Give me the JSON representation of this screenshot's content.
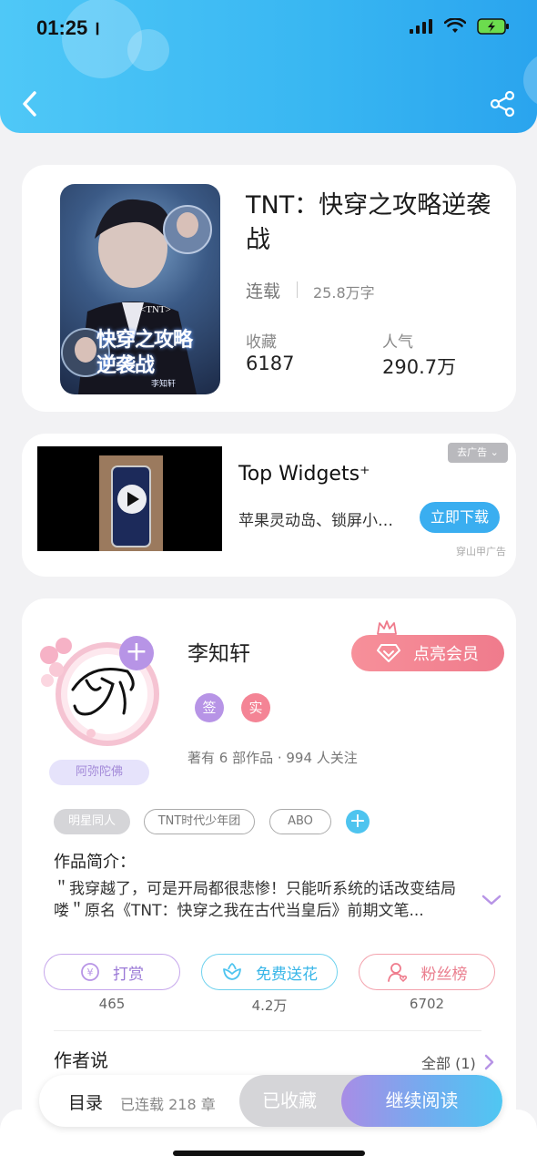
{
  "status_bar": {
    "time": "01:25"
  },
  "book": {
    "title": "TNT：快穿之攻略逆袭战",
    "status": "连载",
    "word_count": "25.8万字",
    "favorites_label": "收藏",
    "favorites_value": "6187",
    "popularity_label": "人气",
    "popularity_value": "290.7万",
    "cover_text_top": "<TNT>",
    "cover_title": "快穿之攻略逆袭战",
    "cover_author": "李知轩"
  },
  "ad": {
    "title": "Top Widgets⁺",
    "subtitle": "苹果灵动岛、锁屏小组件",
    "download_label": "立即下载",
    "remove_ad_label": "去广告",
    "source_label": "穿山甲广告"
  },
  "author": {
    "name": "李知轩",
    "avatar_badge": "阿弥陀佛",
    "vip_label": "点亮会员",
    "badge_sign": "签",
    "badge_real": "实",
    "meta": "著有 6 部作品 · 994 人关注",
    "tags": [
      "明星同人",
      "TNT时代少年团",
      "ABO"
    ]
  },
  "intro": {
    "heading": "作品简介：",
    "text": "＂我穿越了，可是开局都很悲惨！只能听系统的话改变结局喽＂原名《TNT：快穿之我在古代当皇后》前期文笔..."
  },
  "actions": {
    "tip_label": "打赏",
    "tip_count": "465",
    "flower_label": "免费送花",
    "flower_count": "4.2万",
    "fans_label": "粉丝榜",
    "fans_count": "6702"
  },
  "author_says": {
    "heading": "作者说",
    "all_label": "全部 (1)"
  },
  "bottom_bar": {
    "toc_label": "目录",
    "chapters_label": "已连载 218 章",
    "collected_label": "已收藏",
    "continue_label": "继续阅读"
  },
  "colors": {
    "header_blue": "#38b6f2",
    "accent_purple": "#b794e6",
    "accent_pink": "#ef7b8c",
    "accent_cyan": "#4ec4ef"
  }
}
